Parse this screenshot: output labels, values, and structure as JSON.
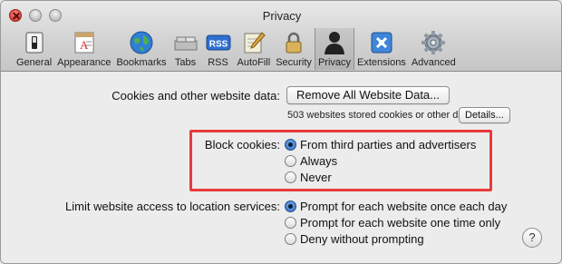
{
  "window": {
    "title": "Privacy"
  },
  "tabs": [
    {
      "label": "General",
      "icon": "switch-icon"
    },
    {
      "label": "Appearance",
      "icon": "font-icon"
    },
    {
      "label": "Bookmarks",
      "icon": "globe-icon"
    },
    {
      "label": "Tabs",
      "icon": "tabs-icon"
    },
    {
      "label": "RSS",
      "icon": "rss-icon"
    },
    {
      "label": "AutoFill",
      "icon": "pencil-icon"
    },
    {
      "label": "Security",
      "icon": "lock-icon"
    },
    {
      "label": "Privacy",
      "icon": "person-icon",
      "active": true
    },
    {
      "label": "Extensions",
      "icon": "puzzle-icon"
    },
    {
      "label": "Advanced",
      "icon": "gear-icon"
    }
  ],
  "cookies": {
    "label": "Cookies and other website data:",
    "remove_button": "Remove All Website Data...",
    "info": "503 websites stored cookies or other data",
    "details_button": "Details..."
  },
  "block": {
    "label": "Block cookies:",
    "options": [
      {
        "label": "From third parties and advertisers",
        "selected": true
      },
      {
        "label": "Always",
        "selected": false
      },
      {
        "label": "Never",
        "selected": false
      }
    ]
  },
  "location": {
    "label": "Limit website access to location services:",
    "options": [
      {
        "label": "Prompt for each website once each day",
        "selected": true
      },
      {
        "label": "Prompt for each website one time only",
        "selected": false
      },
      {
        "label": "Deny without prompting",
        "selected": false
      }
    ]
  },
  "help": {
    "label": "?"
  },
  "colors": {
    "highlight": "#e83a3a",
    "radio_selected": "#2a67c4"
  }
}
